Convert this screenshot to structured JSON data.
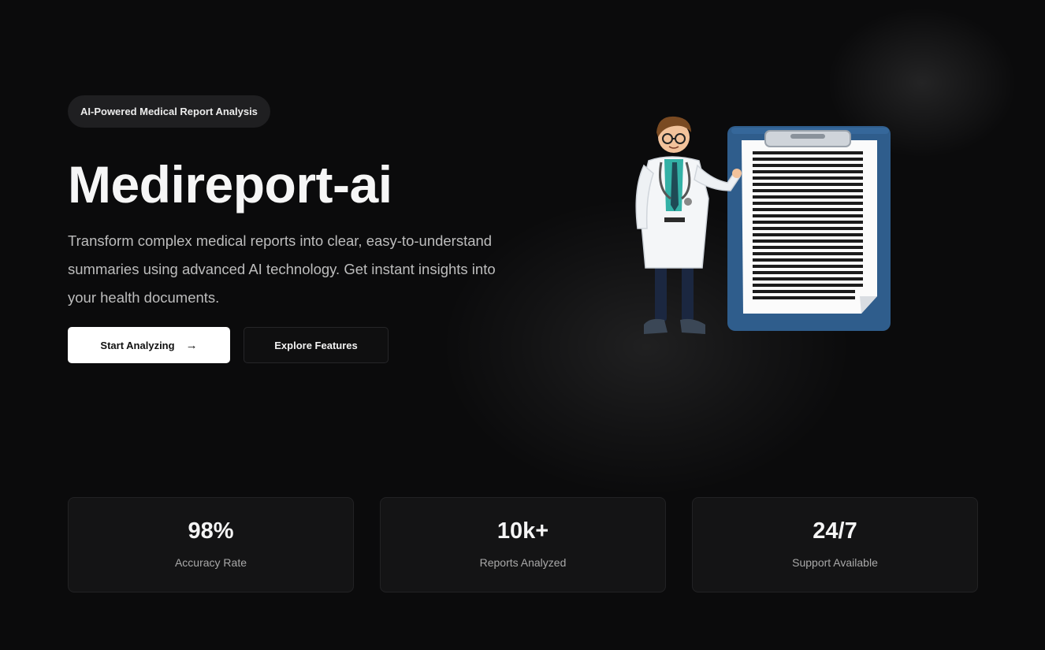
{
  "hero": {
    "badge": "AI-Powered Medical Report Analysis",
    "title": "Medireport-ai",
    "description": "Transform complex medical reports into clear, easy-to-understand summaries using advanced AI technology. Get instant insights into your health documents.",
    "primary_button": "Start Analyzing",
    "primary_button_icon": "arrow-right-icon",
    "secondary_button": "Explore Features",
    "illustration": "doctor-with-clipboard-illustration"
  },
  "stats": [
    {
      "value": "98%",
      "label": "Accuracy Rate"
    },
    {
      "value": "10k+",
      "label": "Reports Analyzed"
    },
    {
      "value": "24/7",
      "label": "Support Available"
    }
  ],
  "colors": {
    "background": "#0b0b0c",
    "card": "#141415",
    "primary_button_bg": "#ffffff",
    "clipboard_blue": "#2f5d8c"
  }
}
